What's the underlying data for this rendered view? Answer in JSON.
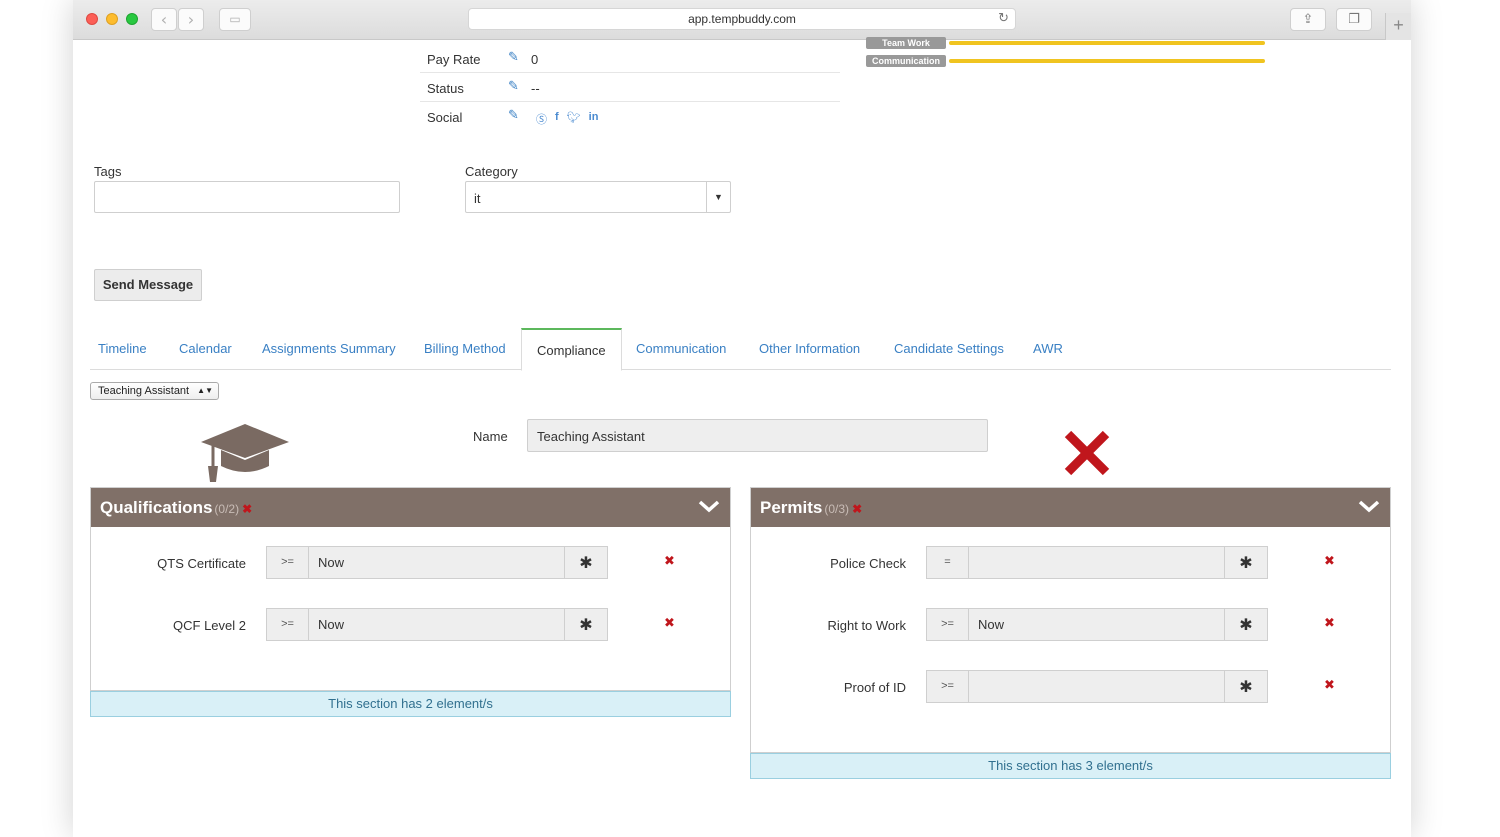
{
  "browser": {
    "url": "app.tempbuddy.com",
    "back_icon": "chevron-left-icon",
    "forward_icon": "chevron-right-icon"
  },
  "profile_info": {
    "rows": [
      {
        "label": "Pay Rate",
        "value": "0"
      },
      {
        "label": "Status",
        "value": "--"
      },
      {
        "label": "Social",
        "value": ""
      }
    ],
    "social_icons": [
      "skype-icon",
      "facebook-icon",
      "twitter-icon",
      "linkedin-icon"
    ]
  },
  "skills": [
    {
      "label": "Team Work",
      "level": 1.0
    },
    {
      "label": "Communication",
      "level": 1.0
    }
  ],
  "form": {
    "tags_label": "Tags",
    "tags_value": "",
    "category_label": "Category",
    "category_value": "it",
    "send_message_label": "Send Message"
  },
  "tabs": [
    {
      "label": "Timeline",
      "active": false
    },
    {
      "label": "Calendar",
      "active": false
    },
    {
      "label": "Assignments Summary",
      "active": false
    },
    {
      "label": "Billing Method",
      "active": false
    },
    {
      "label": "Compliance",
      "active": true
    },
    {
      "label": "Communication",
      "active": false
    },
    {
      "label": "Other Information",
      "active": false
    },
    {
      "label": "Candidate Settings",
      "active": false
    },
    {
      "label": "AWR",
      "active": false
    }
  ],
  "compliance": {
    "role_select": "Teaching Assistant",
    "name_label": "Name",
    "name_value": "Teaching Assistant",
    "status_icon": "cross-icon",
    "accent_color": "#c0161c",
    "header_color": "#807068",
    "panels": [
      {
        "title": "Qualifications",
        "count": "(0/2)",
        "items": [
          {
            "label": "QTS Certificate",
            "operator": ">=",
            "date": "Now"
          },
          {
            "label": "QCF Level 2",
            "operator": ">=",
            "date": "Now"
          }
        ],
        "footer": "This section has 2 element/s"
      },
      {
        "title": "Permits",
        "count": "(0/3)",
        "items": [
          {
            "label": "Police Check",
            "operator": "=",
            "date": ""
          },
          {
            "label": "Right to Work",
            "operator": ">=",
            "date": "Now"
          },
          {
            "label": "Proof of ID",
            "operator": ">=",
            "date": ""
          }
        ],
        "footer": "This section has 3 element/s"
      }
    ]
  }
}
